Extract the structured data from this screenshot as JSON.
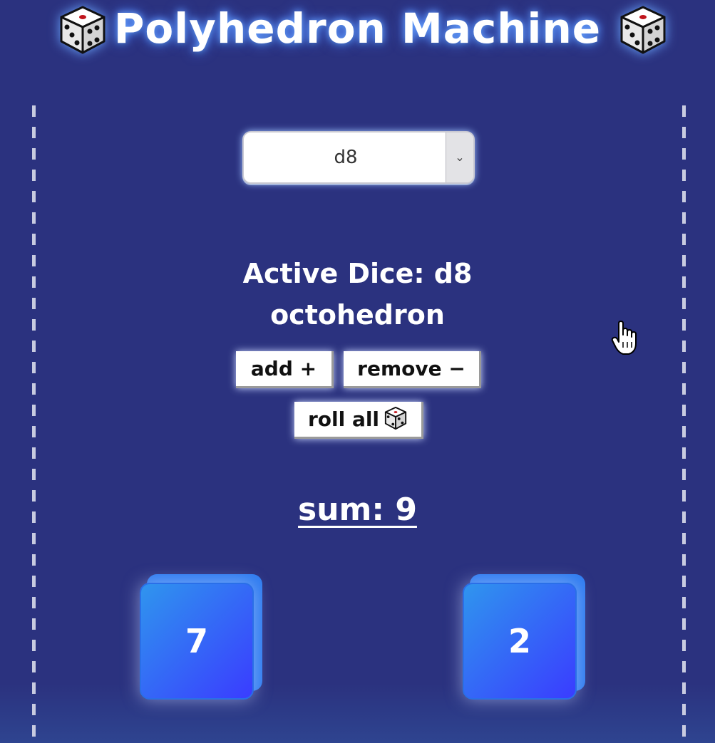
{
  "header": {
    "title": "Polyhedron Machine",
    "icon_left": "dice-icon",
    "icon_right": "dice-icon"
  },
  "dice_select": {
    "selected": "d8"
  },
  "active": {
    "label": "Active Dice: d8",
    "name": "octohedron"
  },
  "buttons": {
    "add": "add +",
    "remove": "remove −",
    "roll_all": "roll all"
  },
  "sum": {
    "label": "sum: 9"
  },
  "dice": [
    {
      "value": "7"
    },
    {
      "value": "2"
    }
  ],
  "colors": {
    "background": "#2b327f",
    "die_gradient_start": "#2f95ee",
    "die_gradient_end": "#3a3cff"
  }
}
